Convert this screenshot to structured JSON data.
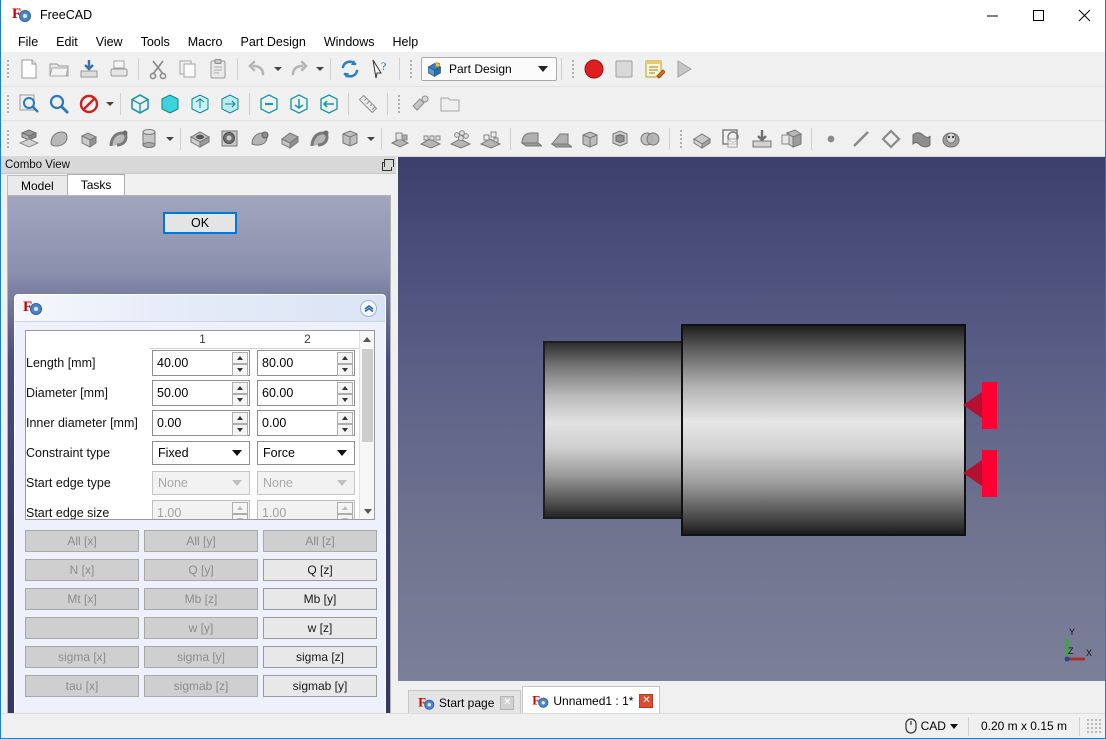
{
  "window": {
    "title": "FreeCAD",
    "logo_icon": "freecad-logo-icon",
    "minimize_label": "minimize-icon",
    "maximize_label": "maximize-icon",
    "close_label": "close-icon"
  },
  "menubar": {
    "items": [
      {
        "label": "File"
      },
      {
        "label": "Edit"
      },
      {
        "label": "View"
      },
      {
        "label": "Tools"
      },
      {
        "label": "Macro"
      },
      {
        "label": "Part Design"
      },
      {
        "label": "Windows"
      },
      {
        "label": "Help"
      }
    ]
  },
  "toolbars": {
    "file_row": {
      "buttons": [
        {
          "icon": "new-document-icon",
          "label": "New"
        },
        {
          "icon": "open-folder-icon",
          "label": "Open"
        },
        {
          "icon": "save-icon",
          "label": "Save"
        },
        {
          "icon": "print-icon",
          "label": "Print"
        },
        {
          "icon": "cut-scissors-icon",
          "label": "Cut"
        },
        {
          "icon": "copy-icon",
          "label": "Copy"
        },
        {
          "icon": "paste-clipboard-icon",
          "label": "Paste"
        },
        {
          "icon": "undo-arrow-icon",
          "label": "Undo"
        },
        {
          "icon": "redo-arrow-icon",
          "label": "Redo"
        },
        {
          "icon": "refresh-icon",
          "label": "Refresh"
        },
        {
          "icon": "whats-this-cursor-icon",
          "label": "What's This"
        }
      ],
      "workbench_selector": {
        "icon": "part-design-workbench-icon",
        "value": "Part Design",
        "dropdown_icon": "chevron-down-icon"
      },
      "macro_buttons": [
        {
          "icon": "macro-record-icon",
          "label": "Macro recording"
        },
        {
          "icon": "macro-stop-icon",
          "label": "Stop macro recording"
        },
        {
          "icon": "macros-edit-icon",
          "label": "Macros"
        },
        {
          "icon": "macro-execute-icon",
          "label": "Execute macro"
        }
      ]
    },
    "view_row": {
      "buttons": [
        {
          "icon": "fit-all-icon",
          "label": "Fit all"
        },
        {
          "icon": "fit-selection-icon",
          "label": "Fit selection"
        },
        {
          "icon": "draw-style-icon",
          "label": "Draw style"
        },
        {
          "icon": "isometric-view-icon",
          "label": "Axonometric"
        },
        {
          "icon": "front-view-icon",
          "label": "Front"
        },
        {
          "icon": "top-view-icon",
          "label": "Top"
        },
        {
          "icon": "right-view-icon",
          "label": "Right"
        },
        {
          "icon": "rear-view-icon",
          "label": "Rear"
        },
        {
          "icon": "bottom-view-icon",
          "label": "Bottom"
        },
        {
          "icon": "left-view-icon",
          "label": "Left"
        },
        {
          "icon": "measure-ruler-icon",
          "label": "Measure"
        },
        {
          "icon": "appearance-icon",
          "label": "Appearance"
        },
        {
          "icon": "folder-empty-icon",
          "label": "Group"
        }
      ]
    },
    "partdesign_row": {
      "buttons": [
        {
          "icon": "pad-icon",
          "label": "Pad"
        },
        {
          "icon": "revolution-icon",
          "label": "Revolution"
        },
        {
          "icon": "additive-loft-icon",
          "label": "Additive loft"
        },
        {
          "icon": "additive-pipe-icon",
          "label": "Additive pipe"
        },
        {
          "icon": "additive-box-icon",
          "label": "Additive box"
        },
        {
          "icon": "pocket-icon",
          "label": "Pocket"
        },
        {
          "icon": "hole-icon",
          "label": "Hole"
        },
        {
          "icon": "groove-icon",
          "label": "Groove"
        },
        {
          "icon": "subtractive-loft-icon",
          "label": "Subtractive loft"
        },
        {
          "icon": "subtractive-pipe-icon",
          "label": "Subtractive pipe"
        },
        {
          "icon": "subtractive-box-icon",
          "label": "Subtractive box"
        },
        {
          "icon": "mirrored-icon",
          "label": "Mirrored"
        },
        {
          "icon": "linear-pattern-icon",
          "label": "Linear pattern"
        },
        {
          "icon": "polar-pattern-icon",
          "label": "Polar pattern"
        },
        {
          "icon": "multi-transform-icon",
          "label": "Multi transform"
        },
        {
          "icon": "fillet-icon",
          "label": "Fillet"
        },
        {
          "icon": "chamfer-icon",
          "label": "Chamfer"
        },
        {
          "icon": "draft-icon",
          "label": "Draft"
        },
        {
          "icon": "thickness-icon",
          "label": "Thickness"
        },
        {
          "icon": "boolean-icon",
          "label": "Boolean"
        },
        {
          "icon": "body-icon",
          "label": "Create body"
        },
        {
          "icon": "sketch-icon",
          "label": "Create sketch"
        },
        {
          "icon": "attach-sketch-icon",
          "label": "Attach sketch"
        },
        {
          "icon": "shapebinder-icon",
          "label": "Shape binder"
        },
        {
          "icon": "point-icon",
          "label": "Create datum point"
        },
        {
          "icon": "line-icon",
          "label": "Create datum line"
        },
        {
          "icon": "plane-icon",
          "label": "Create datum plane"
        },
        {
          "icon": "local-coordinate-icon",
          "label": "Create local coordinate system"
        },
        {
          "icon": "sheep-icon",
          "label": "Clone"
        }
      ]
    }
  },
  "combo_view": {
    "title": "Combo View",
    "float_icon": "float-restore-icon",
    "tabs": [
      {
        "label": "Model",
        "active": false
      },
      {
        "label": "Tasks",
        "active": true
      }
    ]
  },
  "task_panel": {
    "ok_button": "OK",
    "dialog": {
      "logo_icon": "freecad-logo-icon",
      "collapse_icon": "collapse-chevron-up-icon",
      "table": {
        "columns": [
          "",
          "1",
          "2"
        ],
        "rows": [
          {
            "label": "Length [mm]",
            "type": "spin",
            "values": [
              "40.00",
              "80.00"
            ],
            "enabled": [
              true,
              true
            ]
          },
          {
            "label": "Diameter [mm]",
            "type": "spin",
            "values": [
              "50.00",
              "60.00"
            ],
            "enabled": [
              true,
              true
            ]
          },
          {
            "label": "Inner diameter [mm]",
            "type": "spin",
            "values": [
              "0.00",
              "0.00"
            ],
            "enabled": [
              true,
              true
            ]
          },
          {
            "label": "Constraint type",
            "type": "combo",
            "values": [
              "Fixed",
              "Force"
            ],
            "enabled": [
              true,
              true
            ]
          },
          {
            "label": "Start edge type",
            "type": "combo",
            "values": [
              "None",
              "None"
            ],
            "enabled": [
              false,
              false
            ]
          },
          {
            "label": "Start edge size",
            "type": "spin",
            "values": [
              "1.00",
              "1.00"
            ],
            "enabled": [
              false,
              false
            ]
          }
        ],
        "scrollbar": {
          "up_icon": "chevron-up-icon",
          "down_icon": "chevron-down-icon"
        }
      },
      "plot_buttons": [
        {
          "label": "All [x]",
          "active": false
        },
        {
          "label": "All [y]",
          "active": false
        },
        {
          "label": "All [z]",
          "active": false
        },
        {
          "label": "N [x]",
          "active": false
        },
        {
          "label": "Q [y]",
          "active": false
        },
        {
          "label": "Q [z]",
          "active": true
        },
        {
          "label": "Mt [x]",
          "active": false
        },
        {
          "label": "Mb [z]",
          "active": false
        },
        {
          "label": "Mb [y]",
          "active": true
        },
        {
          "label": "",
          "active": false
        },
        {
          "label": "w [y]",
          "active": false
        },
        {
          "label": "w [z]",
          "active": true
        },
        {
          "label": "sigma [x]",
          "active": false
        },
        {
          "label": "sigma [y]",
          "active": false
        },
        {
          "label": "sigma [z]",
          "active": true
        },
        {
          "label": "tau [x]",
          "active": false
        },
        {
          "label": "sigmab [z]",
          "active": false
        },
        {
          "label": "sigmab [y]",
          "active": true
        }
      ]
    }
  },
  "view3d": {
    "background_top": "#3c3f6b",
    "background_bottom": "#7b7f9a",
    "shapes": [
      {
        "name": "small-cylinder-shaft",
        "fill": "metal-gradient"
      },
      {
        "name": "large-cylinder-body",
        "fill": "metal-gradient"
      }
    ],
    "force_markers": [
      {
        "name": "force-arrow-upper",
        "color": "#ff0033"
      },
      {
        "name": "force-arrow-lower",
        "color": "#ff0033"
      }
    ],
    "axis_indicator": {
      "x_label": "X",
      "y_label": "Y",
      "z_label": "Z",
      "x_color": "#a82a2a",
      "y_color": "#2a9a2a",
      "z_color": "#2a2a9a"
    }
  },
  "mdi_tabs": [
    {
      "label": "Start page",
      "icon": "freecad-logo-icon",
      "active": false,
      "close_icon": "close-icon"
    },
    {
      "label": "Unnamed1 : 1*",
      "icon": "freecad-logo-icon",
      "active": true,
      "close_icon": "close-icon"
    }
  ],
  "statusbar": {
    "navigation_icon": "mouse-navigation-icon",
    "navigation_style": "CAD",
    "navigation_dropdown_icon": "chevron-down-icon",
    "dimensions": "0.20 m x 0.15 m",
    "sizegrip_icon": "resize-grip-icon"
  }
}
